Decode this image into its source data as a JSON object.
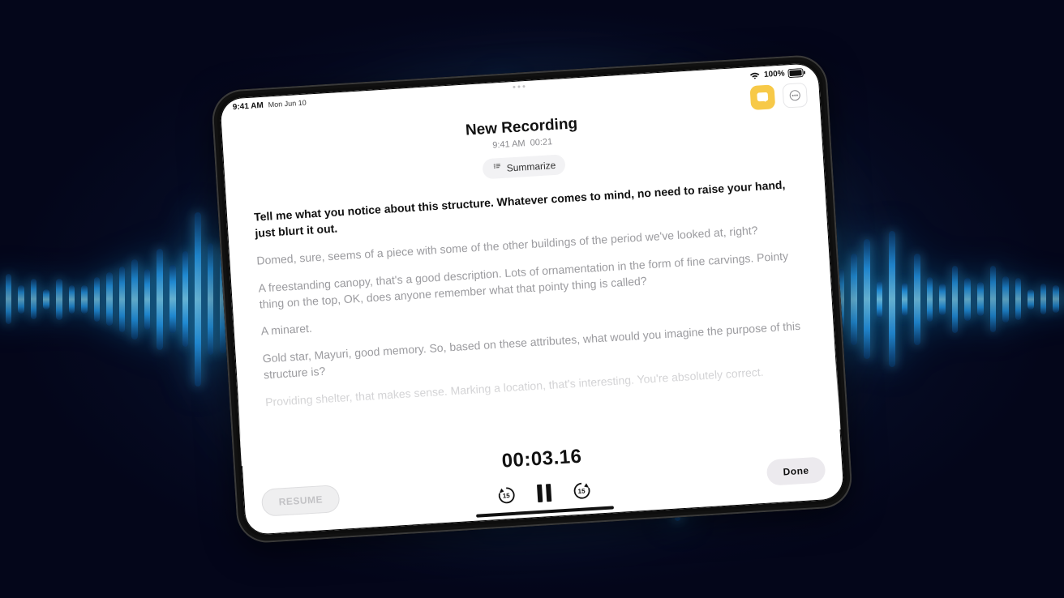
{
  "statusbar": {
    "time": "9:41 AM",
    "date": "Mon Jun 10",
    "battery_pct": "100%"
  },
  "header": {
    "title": "New Recording",
    "meta_time": "9:41 AM",
    "meta_duration": "00:21",
    "summarize_label": "Summarize"
  },
  "transcript": {
    "p1": "Tell me what you notice about this structure. Whatever comes to mind, no need to raise your hand, just blurt it out.",
    "p2": "Domed, sure, seems of a piece with some of the other buildings of the period we've looked at, right?",
    "p3": "A freestanding canopy, that's a good description. Lots of ornamentation in the form of fine carvings. Pointy thing on the top, OK, does anyone remember what that pointy thing is called?",
    "p4": "A minaret.",
    "p5": "Gold star, Mayuri, good memory. So, based on these attributes, what would you imagine the purpose of this structure is?",
    "p6": "Providing shelter, that makes sense. Marking a location, that's interesting. You're absolutely correct."
  },
  "controls": {
    "timer": "00:03.16",
    "resume_label": "RESUME",
    "done_label": "Done",
    "skip_amount": "15"
  }
}
